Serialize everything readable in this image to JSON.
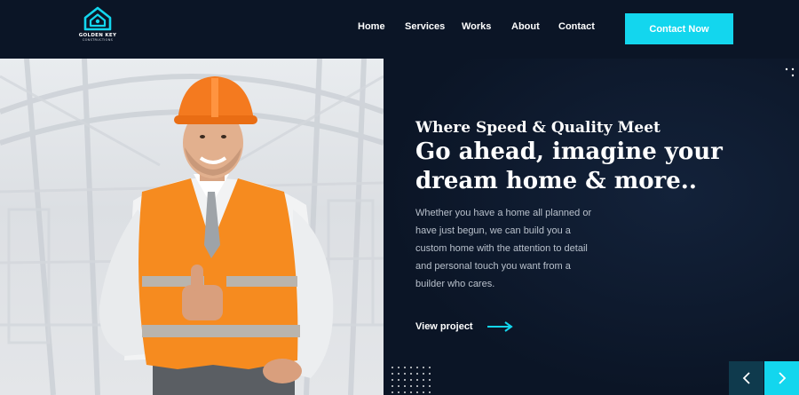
{
  "brand": {
    "name": "GOLDEN KEY",
    "tagline": "CONSTRUCTIONS",
    "icon": "house-key-logo-icon",
    "accent_color": "#13d6ee"
  },
  "nav": {
    "items": [
      {
        "label": "Home"
      },
      {
        "label": "Services"
      },
      {
        "label": "Works"
      },
      {
        "label": "About"
      },
      {
        "label": "Contact"
      }
    ],
    "cta_label": "Contact Now"
  },
  "hero": {
    "tagline": "Where Speed & Quality Meet",
    "headline": "Go ahead, imagine your dream home & more..",
    "body": "Whether you have a home all planned or have just begun, we can build you a custom home with the attention to detail and personal touch you want from a builder who cares.",
    "link_label": "View project",
    "link_icon": "arrow-right-icon",
    "image_alt": "construction worker in orange hard hat and safety vest giving thumbs up"
  },
  "slider": {
    "prev_icon": "chevron-left-icon",
    "next_icon": "chevron-right-icon"
  },
  "colors": {
    "background": "#0b1526",
    "accent": "#13d6ee",
    "prev_button": "#0f3a4d",
    "hard_hat": "#f47a1f",
    "vest": "#f68b1f"
  }
}
